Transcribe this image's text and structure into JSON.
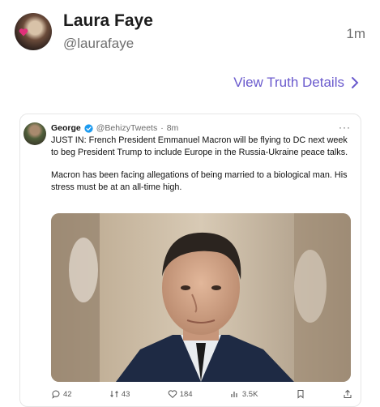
{
  "post": {
    "author_name": "Laura Faye",
    "author_handle": "@laurafaye",
    "time": "1m",
    "details_link": "View Truth Details"
  },
  "embedded_tweet": {
    "name": "George",
    "handle": "@BehizyTweets",
    "separator": "·",
    "time": "8m",
    "more": "···",
    "paragraph1": "JUST IN: French President Emmanuel Macron will be flying to DC next week to beg President Trump to include Europe in the Russia-Ukraine peace talks.",
    "paragraph2": "Macron has been facing allegations of being married to a biological man. His stress must be at an all-time high.",
    "stats": {
      "replies": "42",
      "retweets": "43",
      "likes": "184",
      "views": "3.5K"
    }
  },
  "icons": {
    "avatar": "profile-photo",
    "chevron": "chevron-right-icon",
    "verified": "verified-badge-icon",
    "reply": "reply-icon",
    "retweet": "retweet-icon",
    "like": "heart-icon",
    "views": "views-icon",
    "bookmark": "bookmark-icon",
    "share": "share-icon"
  },
  "colors": {
    "link": "#6a5acd",
    "verified": "#1d9bf0",
    "name": "#1c1c1c",
    "muted": "#6f6f6f"
  }
}
